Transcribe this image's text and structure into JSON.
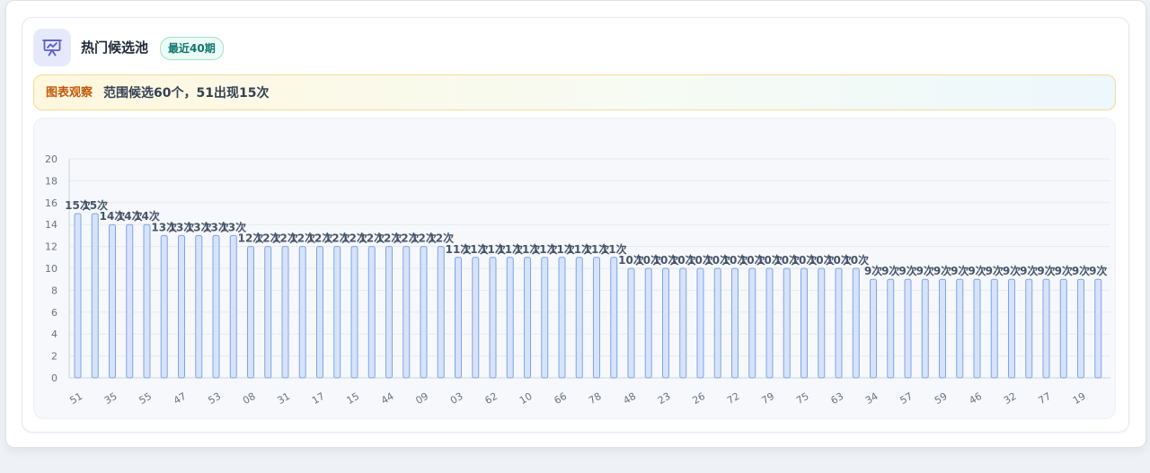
{
  "header": {
    "title": "热门候选池",
    "badge": "最近40期",
    "icon": "presentation-chart-icon"
  },
  "notice": {
    "tag": "图表观察",
    "text": "范围候选60个，51出现15次"
  },
  "colors": {
    "bar_fill": "#d6e3fb",
    "bar_stroke": "#7ea4e6",
    "accent": "#5b5fc7"
  },
  "chart_data": {
    "type": "bar",
    "ylim": [
      0,
      20
    ],
    "yticks": [
      0,
      2,
      4,
      6,
      8,
      10,
      12,
      14,
      16,
      18,
      20
    ],
    "grid": true,
    "label_suffix": "次",
    "categories": [
      "51",
      "?",
      "35",
      "?",
      "55",
      "?",
      "47",
      "?",
      "53",
      "?",
      "08",
      "?",
      "31",
      "?",
      "17",
      "?",
      "15",
      "?",
      "44",
      "?",
      "09",
      "?",
      "03",
      "?",
      "62",
      "?",
      "10",
      "?",
      "66",
      "?",
      "78",
      "?",
      "48",
      "?",
      "23",
      "?",
      "26",
      "?",
      "72",
      "?",
      "79",
      "?",
      "75",
      "?",
      "63",
      "?",
      "34",
      "?",
      "57",
      "?",
      "59",
      "?",
      "46",
      "?",
      "32",
      "?",
      "77",
      "?",
      "19",
      "?"
    ],
    "shown_tick_labels": [
      "51",
      "35",
      "55",
      "47",
      "53",
      "08",
      "31",
      "17",
      "15",
      "44",
      "09",
      "03",
      "62",
      "10",
      "66",
      "78",
      "48",
      "23",
      "26",
      "72",
      "79",
      "75",
      "63",
      "34",
      "57",
      "59",
      "46",
      "32",
      "77",
      "19"
    ],
    "values": [
      15,
      15,
      14,
      14,
      14,
      13,
      13,
      13,
      13,
      13,
      12,
      12,
      12,
      12,
      12,
      12,
      12,
      12,
      12,
      12,
      12,
      12,
      11,
      11,
      11,
      11,
      11,
      11,
      11,
      11,
      11,
      11,
      10,
      10,
      10,
      10,
      10,
      10,
      10,
      10,
      10,
      10,
      10,
      10,
      10,
      10,
      9,
      9,
      9,
      9,
      9,
      9,
      9,
      9,
      9,
      9,
      9,
      9,
      9,
      9
    ]
  }
}
